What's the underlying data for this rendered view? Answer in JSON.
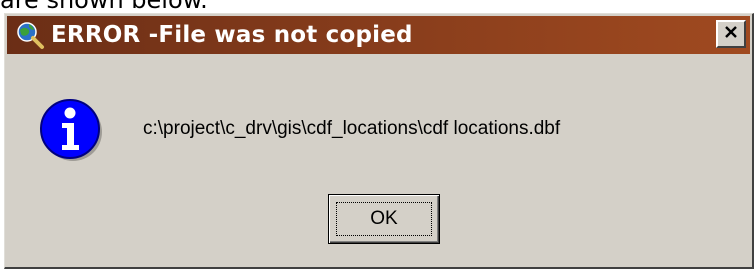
{
  "page": {
    "caption": "are shown below."
  },
  "dialog": {
    "title": "ERROR -File was not copied",
    "close_label": "×",
    "message": "c:\\project\\c_drv\\gis\\cdf_locations\\cdf locations.dbf",
    "ok_label": "OK",
    "icons": {
      "app": "magnifier-globe-icon",
      "info": "info-icon",
      "close": "close-icon"
    }
  }
}
